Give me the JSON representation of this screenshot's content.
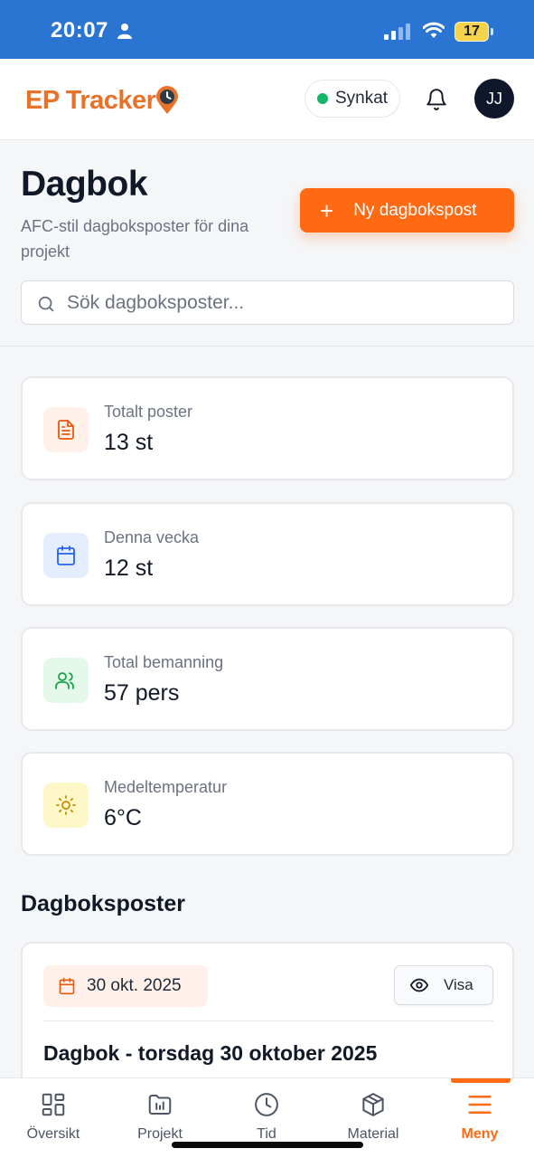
{
  "status_bar": {
    "time": "20:07",
    "battery": "17",
    "icons": [
      "person-icon",
      "cellular-signal-icon",
      "wifi-icon",
      "battery-icon"
    ]
  },
  "header": {
    "logo_text": "EP Tracker",
    "sync_label": "Synkat",
    "avatar_initials": "JJ",
    "colors": {
      "brand": "#e8722a",
      "sync_dot": "#12b76a"
    },
    "icons": [
      "location-pin-clock-icon",
      "bell-icon"
    ]
  },
  "page": {
    "title": "Dagbok",
    "subtitle": "AFC-stil dagboksposter för dina projekt",
    "new_button_label": "Ny dagbokspost",
    "search_placeholder": "Sök dagboksposter...",
    "accent": "#ff6a13"
  },
  "stats": [
    {
      "label": "Totalt poster",
      "value": "13 st",
      "icon": "document-icon",
      "color": "#ea580c"
    },
    {
      "label": "Denna vecka",
      "value": "12 st",
      "icon": "calendar-icon",
      "color": "#2563eb"
    },
    {
      "label": "Total bemanning",
      "value": "57 pers",
      "icon": "users-icon",
      "color": "#16a34a"
    },
    {
      "label": "Medeltemperatur",
      "value": "6°C",
      "icon": "sun-icon",
      "color": "#ca8a04"
    }
  ],
  "entries_section": {
    "title": "Dagboksposter",
    "entries": [
      {
        "date": "30 okt. 2025",
        "view_label": "Visa",
        "title": "Dagbok - torsdag 30 oktober 2025"
      }
    ]
  },
  "bottom_nav": {
    "items": [
      {
        "label": "Översikt",
        "icon": "dashboard-grid-icon",
        "active": false
      },
      {
        "label": "Projekt",
        "icon": "project-folder-icon",
        "active": false
      },
      {
        "label": "Tid",
        "icon": "clock-icon",
        "active": false
      },
      {
        "label": "Material",
        "icon": "package-icon",
        "active": false
      },
      {
        "label": "Meny",
        "icon": "menu-icon",
        "active": true
      }
    ]
  }
}
